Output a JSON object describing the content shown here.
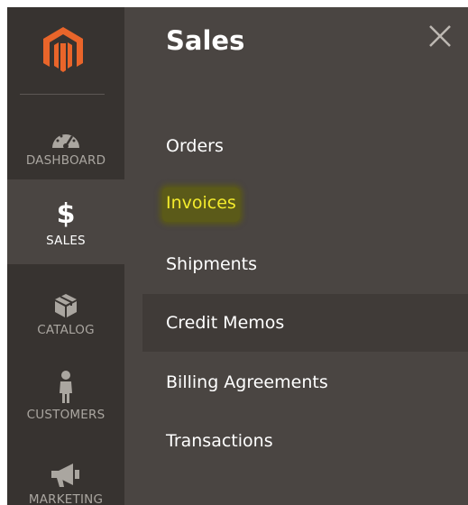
{
  "sidebar": {
    "logo": "magento-logo",
    "items": [
      {
        "label": "DASHBOARD",
        "icon": "dashboard-gauge-icon",
        "active": false
      },
      {
        "label": "$",
        "sub": "SALES",
        "icon": "dollar-icon",
        "active": true
      },
      {
        "label": "CATALOG",
        "icon": "box-icon",
        "active": false
      },
      {
        "label": "CUSTOMERS",
        "icon": "person-icon",
        "active": false
      },
      {
        "label": "MARKETING",
        "icon": "megaphone-icon",
        "active": false
      }
    ]
  },
  "panel": {
    "title": "Sales",
    "close_icon": "close-icon",
    "menu": [
      {
        "label": "Orders"
      },
      {
        "label": "Invoices",
        "highlighted": true
      },
      {
        "label": "Shipments"
      },
      {
        "label": "Credit Memos",
        "hover": true
      },
      {
        "label": "Billing Agreements"
      },
      {
        "label": "Transactions"
      }
    ]
  },
  "colors": {
    "sidebar_bg": "#373330",
    "panel_bg": "#4a4542",
    "logo_orange": "#e9652a",
    "highlight_text": "#f4ec2c"
  }
}
